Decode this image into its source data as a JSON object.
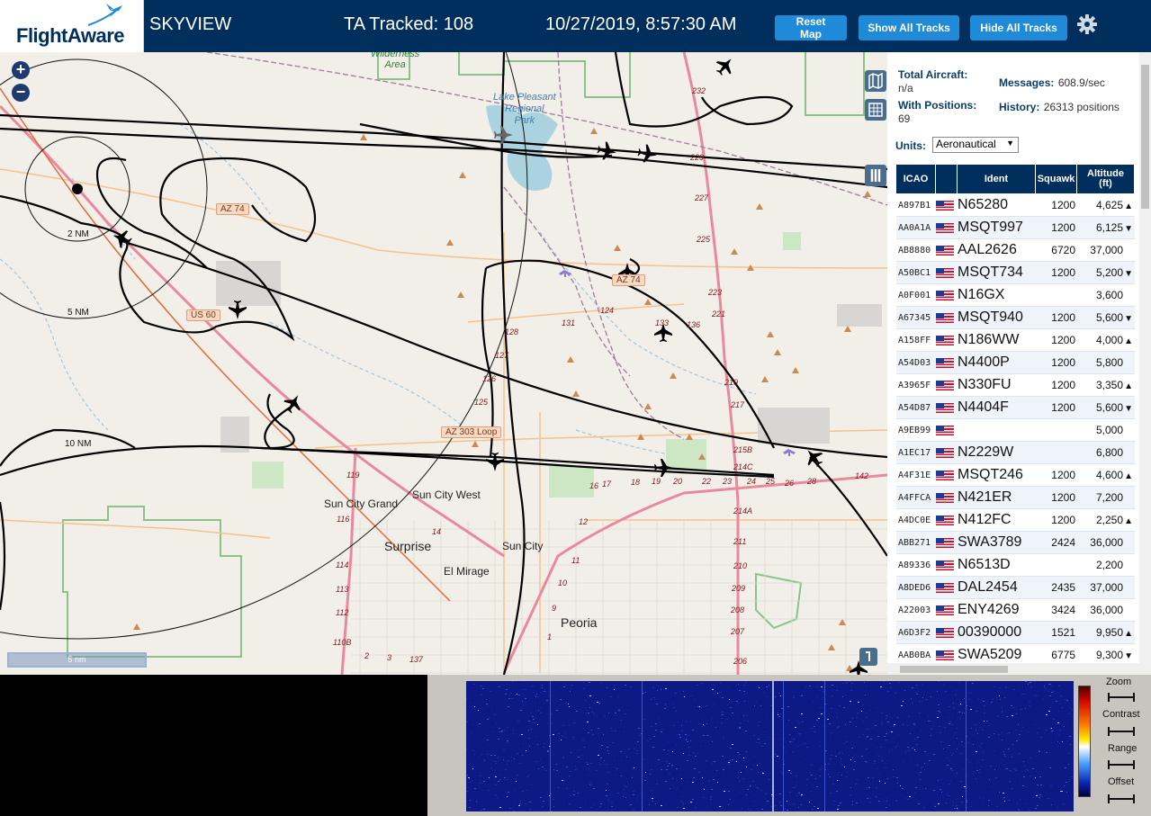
{
  "header": {
    "logo": "FlightAware",
    "app_title": "SKYVIEW",
    "ta_tracked": "TA Tracked: 108",
    "datetime": "10/27/2019, 8:57:30 AM",
    "buttons": {
      "reset_map": "Reset Map",
      "show_all": "Show All Tracks",
      "hide_all": "Hide All Tracks"
    },
    "brand_color": "#002f5d",
    "button_color": "#1e8ad8"
  },
  "map": {
    "zoom_in": "+",
    "zoom_out": "−",
    "range_rings": [
      "2 NM",
      "5 NM",
      "10 NM"
    ],
    "places": {
      "wilderness": "Wilderness\nArea",
      "lake": "Lake Pleasant\nRegional\nPark",
      "sun_city_grand": "Sun City Grand",
      "sun_city_west": "Sun City West",
      "surprise": "Surprise",
      "sun_city": "Sun City",
      "el_mirage": "El Mirage",
      "peoria": "Peoria"
    },
    "shields": {
      "az74_a": "AZ 74",
      "az74_b": "AZ 74",
      "us60": "US 60",
      "az303": "AZ 303 Loop"
    },
    "scale": "5 nm",
    "exit_numbers": [
      "232",
      "229",
      "227",
      "225",
      "223",
      "221",
      "219",
      "217",
      "215B",
      "214C",
      "214A",
      "211",
      "210",
      "209",
      "208",
      "207",
      "206",
      "131",
      "128",
      "127",
      "126",
      "125",
      "119",
      "116",
      "114",
      "113",
      "112",
      "110B",
      "16",
      "17",
      "18",
      "19",
      "20",
      "22",
      "23",
      "24",
      "25",
      "26",
      "28",
      "142",
      "14",
      "12",
      "11",
      "10",
      "9",
      "1",
      "2",
      "3",
      "137",
      "136",
      "133",
      "124"
    ]
  },
  "stats": {
    "total_aircraft_label": "Total Aircraft:",
    "total_aircraft": "n/a",
    "with_positions_label": "With Positions:",
    "with_positions": "69",
    "messages_label": "Messages:",
    "messages": "608.9/sec",
    "history_label": "History:",
    "history": "26313 positions",
    "units_label": "Units:",
    "units_value": "Aeronautical"
  },
  "table": {
    "headers": {
      "icao": "ICAO",
      "ident": "Ident",
      "squawk": "Squawk",
      "altitude": "Altitude\n(ft)"
    },
    "rows": [
      {
        "icao": "A897B1",
        "ident": "N65280",
        "squawk": "1200",
        "alt": "4,625",
        "trend": "▲"
      },
      {
        "icao": "AA0A1A",
        "ident": "MSQT997",
        "squawk": "1200",
        "alt": "6,125",
        "trend": "▼"
      },
      {
        "icao": "AB8880",
        "ident": "AAL2626",
        "squawk": "6720",
        "alt": "37,000",
        "trend": ""
      },
      {
        "icao": "A50BC1",
        "ident": "MSQT734",
        "squawk": "1200",
        "alt": "5,200",
        "trend": "▼"
      },
      {
        "icao": "A0F001",
        "ident": "N16GX",
        "squawk": "",
        "alt": "3,600",
        "trend": ""
      },
      {
        "icao": "A67345",
        "ident": "MSQT940",
        "squawk": "1200",
        "alt": "5,600",
        "trend": "▼"
      },
      {
        "icao": "A158FF",
        "ident": "N186WW",
        "squawk": "1200",
        "alt": "4,000",
        "trend": "▲"
      },
      {
        "icao": "A54D03",
        "ident": "N4400P",
        "squawk": "1200",
        "alt": "5,800",
        "trend": ""
      },
      {
        "icao": "A3965F",
        "ident": "N330FU",
        "squawk": "1200",
        "alt": "3,350",
        "trend": "▲"
      },
      {
        "icao": "A54D87",
        "ident": "N4404F",
        "squawk": "1200",
        "alt": "5,600",
        "trend": "▼"
      },
      {
        "icao": "A9EB99",
        "ident": "",
        "squawk": "",
        "alt": "5,000",
        "trend": ""
      },
      {
        "icao": "A1EC17",
        "ident": "N2229W",
        "squawk": "",
        "alt": "6,800",
        "trend": ""
      },
      {
        "icao": "A4F31E",
        "ident": "MSQT246",
        "squawk": "1200",
        "alt": "4,600",
        "trend": "▲"
      },
      {
        "icao": "A4FFCA",
        "ident": "N421ER",
        "squawk": "1200",
        "alt": "7,200",
        "trend": ""
      },
      {
        "icao": "A4DC0E",
        "ident": "N412FC",
        "squawk": "1200",
        "alt": "2,250",
        "trend": "▲"
      },
      {
        "icao": "ABB271",
        "ident": "SWA3789",
        "squawk": "2424",
        "alt": "36,000",
        "trend": ""
      },
      {
        "icao": "A89336",
        "ident": "N6513D",
        "squawk": "",
        "alt": "2,200",
        "trend": ""
      },
      {
        "icao": "A8DED6",
        "ident": "DAL2454",
        "squawk": "2435",
        "alt": "37,000",
        "trend": ""
      },
      {
        "icao": "A22003",
        "ident": "ENY4269",
        "squawk": "3424",
        "alt": "36,000",
        "trend": ""
      },
      {
        "icao": "A6D3F2",
        "ident": "00390000",
        "squawk": "1521",
        "alt": "9,950",
        "trend": "▲"
      },
      {
        "icao": "AAB0BA",
        "ident": "SWA5209",
        "squawk": "6775",
        "alt": "9,300",
        "trend": "▼"
      }
    ]
  },
  "spectrum": {
    "controls": [
      "Zoom",
      "Contrast",
      "Range",
      "Offset"
    ]
  }
}
